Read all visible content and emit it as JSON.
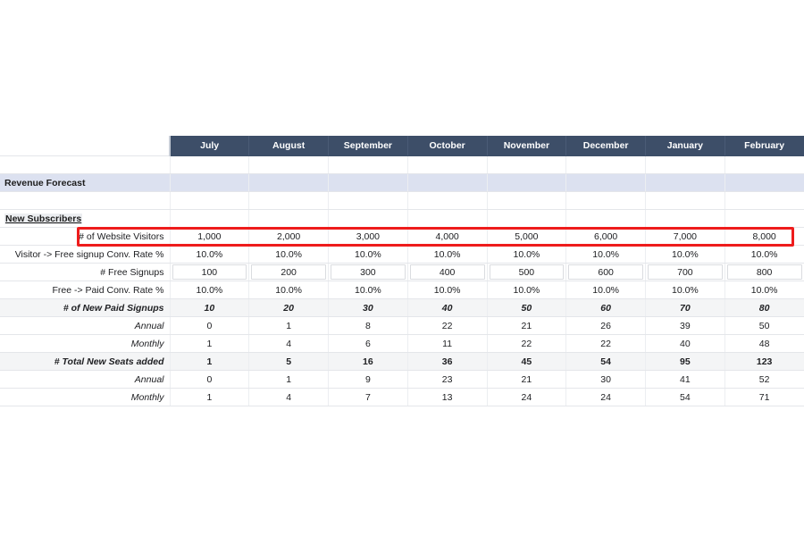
{
  "sheet": {
    "months": [
      "July",
      "August",
      "September",
      "October",
      "November",
      "December",
      "January",
      "February"
    ],
    "section_title": "Revenue Forecast",
    "subsection_title": "New Subscribers",
    "rows": [
      {
        "label": "# of Website Visitors",
        "values": [
          "1,000",
          "2,000",
          "3,000",
          "4,000",
          "5,000",
          "6,000",
          "7,000",
          "8,000"
        ]
      },
      {
        "label": "Visitor -> Free signup Conv. Rate %",
        "values": [
          "10.0%",
          "10.0%",
          "10.0%",
          "10.0%",
          "10.0%",
          "10.0%",
          "10.0%",
          "10.0%"
        ]
      },
      {
        "label": "# Free Signups",
        "values": [
          "100",
          "200",
          "300",
          "400",
          "500",
          "600",
          "700",
          "800"
        ]
      },
      {
        "label": "Free -> Paid Conv. Rate %",
        "values": [
          "10.0%",
          "10.0%",
          "10.0%",
          "10.0%",
          "10.0%",
          "10.0%",
          "10.0%",
          "10.0%"
        ]
      },
      {
        "label": "# of New Paid Signups",
        "values": [
          "10",
          "20",
          "30",
          "40",
          "50",
          "60",
          "70",
          "80"
        ]
      },
      {
        "label": "Annual",
        "values": [
          "0",
          "1",
          "8",
          "22",
          "21",
          "26",
          "39",
          "50"
        ]
      },
      {
        "label": "Monthly",
        "values": [
          "1",
          "4",
          "6",
          "11",
          "22",
          "22",
          "40",
          "48"
        ]
      },
      {
        "label": "# Total New Seats added",
        "values": [
          "1",
          "5",
          "16",
          "36",
          "45",
          "54",
          "95",
          "123"
        ]
      },
      {
        "label": "Annual",
        "values": [
          "0",
          "1",
          "9",
          "23",
          "21",
          "30",
          "41",
          "52"
        ]
      },
      {
        "label": "Monthly",
        "values": [
          "1",
          "4",
          "7",
          "13",
          "24",
          "24",
          "54",
          "71"
        ]
      }
    ]
  },
  "highlight": {
    "color": "#ee1c1c",
    "target_row_label": "# of Website Visitors"
  },
  "colors": {
    "header_bg": "#3d4e68",
    "band_bg": "#dce1f0",
    "total_bg": "#f4f5f6",
    "grid_line": "#e4e6ea"
  }
}
